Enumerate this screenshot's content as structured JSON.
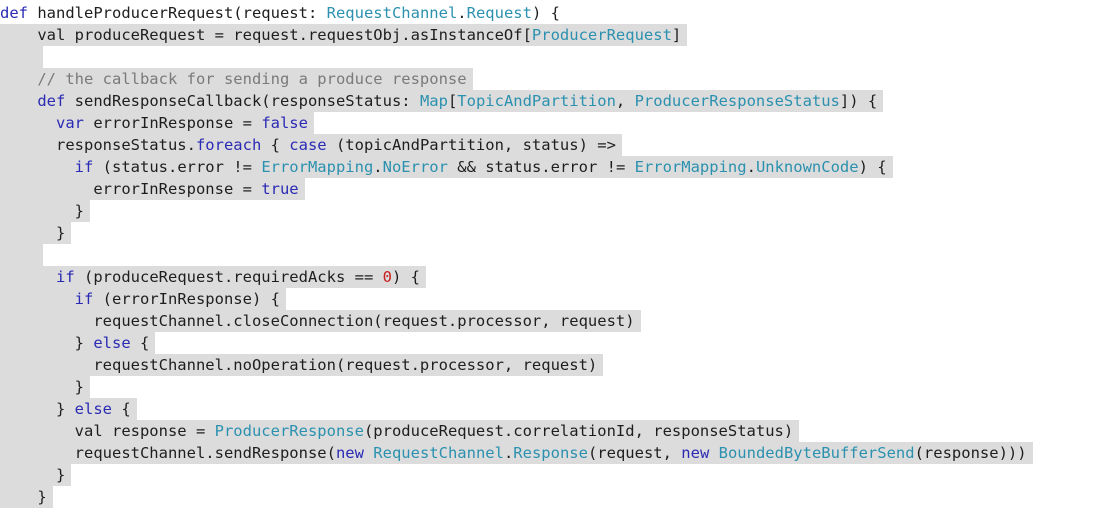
{
  "code_lines": [
    [
      {
        "t": "def",
        "c": "kw"
      },
      {
        "t": " handleProducerRequest(request: ",
        "c": ""
      },
      {
        "t": "RequestChannel",
        "c": "ty"
      },
      {
        "t": ".",
        "c": ""
      },
      {
        "t": "Request",
        "c": "ty"
      },
      {
        "t": ") {",
        "c": ""
      }
    ],
    [
      {
        "t": "    val produceRequest = request.requestObj.asInstanceOf[",
        "c": ""
      },
      {
        "t": "ProducerRequest",
        "c": "ty"
      },
      {
        "t": "]",
        "c": ""
      }
    ],
    [
      {
        "t": "    ",
        "c": ""
      }
    ],
    [
      {
        "t": "    ",
        "c": ""
      },
      {
        "t": "// the callback for sending a produce response",
        "c": "cm"
      }
    ],
    [
      {
        "t": "    ",
        "c": ""
      },
      {
        "t": "def",
        "c": "kw"
      },
      {
        "t": " sendResponseCallback(responseStatus: ",
        "c": ""
      },
      {
        "t": "Map",
        "c": "ty"
      },
      {
        "t": "[",
        "c": ""
      },
      {
        "t": "TopicAndPartition",
        "c": "ty"
      },
      {
        "t": ", ",
        "c": ""
      },
      {
        "t": "ProducerResponseStatus",
        "c": "ty"
      },
      {
        "t": "]) {",
        "c": ""
      }
    ],
    [
      {
        "t": "      ",
        "c": ""
      },
      {
        "t": "var",
        "c": "kw"
      },
      {
        "t": " errorInResponse = ",
        "c": ""
      },
      {
        "t": "false",
        "c": "kw"
      }
    ],
    [
      {
        "t": "      responseStatus.",
        "c": ""
      },
      {
        "t": "foreach",
        "c": "kw"
      },
      {
        "t": " { ",
        "c": ""
      },
      {
        "t": "case",
        "c": "kw"
      },
      {
        "t": " (topicAndPartition, status) =>",
        "c": ""
      }
    ],
    [
      {
        "t": "        ",
        "c": ""
      },
      {
        "t": "if",
        "c": "kw"
      },
      {
        "t": " (status.error != ",
        "c": ""
      },
      {
        "t": "ErrorMapping",
        "c": "ty"
      },
      {
        "t": ".",
        "c": ""
      },
      {
        "t": "NoError",
        "c": "ty"
      },
      {
        "t": " && status.error != ",
        "c": ""
      },
      {
        "t": "ErrorMapping",
        "c": "ty"
      },
      {
        "t": ".",
        "c": ""
      },
      {
        "t": "UnknownCode",
        "c": "ty"
      },
      {
        "t": ") {",
        "c": ""
      }
    ],
    [
      {
        "t": "          errorInResponse = ",
        "c": ""
      },
      {
        "t": "true",
        "c": "kw"
      }
    ],
    [
      {
        "t": "        }",
        "c": ""
      }
    ],
    [
      {
        "t": "      }",
        "c": ""
      }
    ],
    [
      {
        "t": "    ",
        "c": ""
      }
    ],
    [
      {
        "t": "      ",
        "c": ""
      },
      {
        "t": "if",
        "c": "kw"
      },
      {
        "t": " (produceRequest.requiredAcks == ",
        "c": ""
      },
      {
        "t": "0",
        "c": "num"
      },
      {
        "t": ") {",
        "c": ""
      }
    ],
    [
      {
        "t": "        ",
        "c": ""
      },
      {
        "t": "if",
        "c": "kw"
      },
      {
        "t": " (errorInResponse) {",
        "c": ""
      }
    ],
    [
      {
        "t": "          requestChannel.closeConnection(request.processor, request)",
        "c": ""
      }
    ],
    [
      {
        "t": "        } ",
        "c": ""
      },
      {
        "t": "else",
        "c": "kw"
      },
      {
        "t": " {",
        "c": ""
      }
    ],
    [
      {
        "t": "          requestChannel.noOperation(request.processor, request)",
        "c": ""
      }
    ],
    [
      {
        "t": "        }",
        "c": ""
      }
    ],
    [
      {
        "t": "      } ",
        "c": ""
      },
      {
        "t": "else",
        "c": "kw"
      },
      {
        "t": " {",
        "c": ""
      }
    ],
    [
      {
        "t": "        val response = ",
        "c": ""
      },
      {
        "t": "ProducerResponse",
        "c": "ty"
      },
      {
        "t": "(produceRequest.correlationId, responseStatus)",
        "c": ""
      }
    ],
    [
      {
        "t": "        requestChannel.sendResponse(",
        "c": ""
      },
      {
        "t": "new",
        "c": "kw"
      },
      {
        "t": " ",
        "c": ""
      },
      {
        "t": "RequestChannel",
        "c": "ty"
      },
      {
        "t": ".",
        "c": ""
      },
      {
        "t": "Response",
        "c": "ty"
      },
      {
        "t": "(request, ",
        "c": ""
      },
      {
        "t": "new",
        "c": "kw"
      },
      {
        "t": " ",
        "c": ""
      },
      {
        "t": "BoundedByteBufferSend",
        "c": "ty"
      },
      {
        "t": "(response)))",
        "c": ""
      }
    ],
    [
      {
        "t": "      }",
        "c": ""
      }
    ],
    [
      {
        "t": "    }",
        "c": ""
      }
    ]
  ],
  "highlight_start_line": 1
}
